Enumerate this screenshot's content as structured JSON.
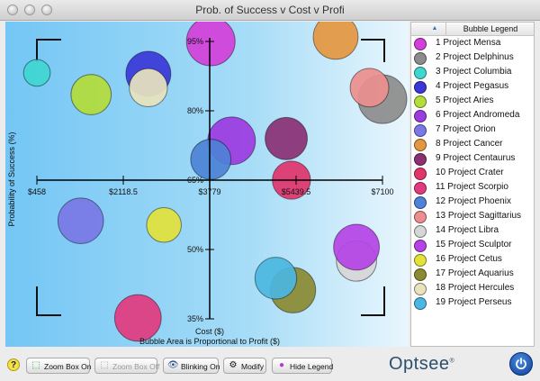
{
  "window": {
    "title": "Prob. of Success v Cost v Profi"
  },
  "legend": {
    "title": "Bubble Legend",
    "sort_icon": "sort-ascending-icon",
    "items": [
      {
        "label": "1 Project Mensa",
        "color": "#d33fd8"
      },
      {
        "label": "2 Project Delphinus",
        "color": "#8c8c8c"
      },
      {
        "label": "3 Project Columbia",
        "color": "#3fd6d0"
      },
      {
        "label": "4 Project Pegasus",
        "color": "#3a37d6"
      },
      {
        "label": "5 Project Aries",
        "color": "#b4dc3a"
      },
      {
        "label": "6 Project Andromeda",
        "color": "#9c3be0"
      },
      {
        "label": "7 Project Orion",
        "color": "#7a78e6"
      },
      {
        "label": "8 Project Cancer",
        "color": "#e59640"
      },
      {
        "label": "9 Project Centaurus",
        "color": "#8a3073"
      },
      {
        "label": "10 Project Crater",
        "color": "#e0346b"
      },
      {
        "label": "11 Project Scorpio",
        "color": "#e23a7e"
      },
      {
        "label": "12 Project Phoenix",
        "color": "#4d82d6"
      },
      {
        "label": "13 Project Sagittarius",
        "color": "#ec8e8e"
      },
      {
        "label": "14 Project Libra",
        "color": "#d6d6d6"
      },
      {
        "label": "15 Project Sculptor",
        "color": "#b543e6"
      },
      {
        "label": "16 Project Cetus",
        "color": "#e2e23a"
      },
      {
        "label": "17 Project Aquarius",
        "color": "#8a8a32"
      },
      {
        "label": "18 Project Hercules",
        "color": "#e8e3bd"
      },
      {
        "label": "19 Project Perseus",
        "color": "#4bb6e0"
      }
    ]
  },
  "chart_data": {
    "type": "scatter",
    "title": "",
    "xlabel": "Cost ($)",
    "ylabel": "Probability of Success (%)",
    "footnote": "Bubble Area is Proportional to Profit ($)",
    "x_ticks": [
      "$458",
      "$2118.5",
      "$3779",
      "$5439.5",
      "$7100"
    ],
    "y_ticks": [
      "95%",
      "80%",
      "65%",
      "50%",
      "35%"
    ],
    "xlim": [
      458,
      7100
    ],
    "ylim": [
      35,
      95
    ],
    "points": [
      {
        "name": "Project Mensa",
        "x": 3800,
        "y": 95,
        "size": 1.0
      },
      {
        "name": "Project Delphinus",
        "x": 7100,
        "y": 82.5,
        "size": 1.0
      },
      {
        "name": "Project Columbia",
        "x": 458,
        "y": 88.2,
        "size": 0.2
      },
      {
        "name": "Project Pegasus",
        "x": 2600,
        "y": 88,
        "size": 0.82
      },
      {
        "name": "Project Aries",
        "x": 1500,
        "y": 83.5,
        "size": 0.62
      },
      {
        "name": "Project Andromeda",
        "x": 4200,
        "y": 73.5,
        "size": 0.95
      },
      {
        "name": "Project Orion",
        "x": 1300,
        "y": 56.2,
        "size": 0.85
      },
      {
        "name": "Project Cancer",
        "x": 6200,
        "y": 96,
        "size": 0.82
      },
      {
        "name": "Project Centaurus",
        "x": 5250,
        "y": 74,
        "size": 0.7
      },
      {
        "name": "Project Crater",
        "x": 5350,
        "y": 65,
        "size": 0.54
      },
      {
        "name": "Project Scorpio",
        "x": 2400,
        "y": 35.2,
        "size": 0.9
      },
      {
        "name": "Project Phoenix",
        "x": 3800,
        "y": 69.5,
        "size": 0.62
      },
      {
        "name": "Project Sagittarius",
        "x": 6850,
        "y": 85,
        "size": 0.56
      },
      {
        "name": "Project Libra",
        "x": 6600,
        "y": 47.5,
        "size": 0.62
      },
      {
        "name": "Project Sculptor",
        "x": 6600,
        "y": 50.5,
        "size": 0.86
      },
      {
        "name": "Project Cetus",
        "x": 2900,
        "y": 55.3,
        "size": 0.42
      },
      {
        "name": "Project Aquarius",
        "x": 5380,
        "y": 41.2,
        "size": 0.84
      },
      {
        "name": "Project Hercules",
        "x": 2600,
        "y": 85,
        "size": 0.54
      },
      {
        "name": "Project Perseus",
        "x": 5050,
        "y": 43.8,
        "size": 0.68
      }
    ]
  },
  "toolbar": {
    "help_label": "?",
    "zoom_on_label": "Zoom Box On",
    "zoom_off_label": "Zoom Box Off",
    "blinking_label": "Blinking On",
    "modify_label": "Modify",
    "hide_legend_label": "Hide Legend"
  },
  "brand": {
    "name": "Optsee",
    "mark": "®"
  }
}
